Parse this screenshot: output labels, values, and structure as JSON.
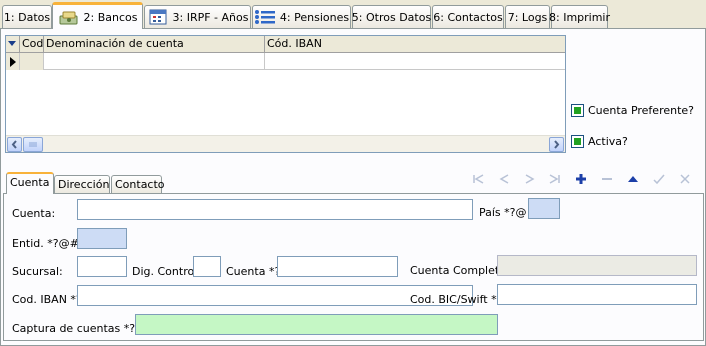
{
  "top_tabs": [
    {
      "label": "1: Datos",
      "icon": "none"
    },
    {
      "label": "2: Bancos",
      "icon": "money-icon",
      "active": true
    },
    {
      "label": "3: IRPF - Años",
      "icon": "calendar-icon"
    },
    {
      "label": "4: Pensiones",
      "icon": "list-icon"
    },
    {
      "label": "5: Otros Datos",
      "icon": "none"
    },
    {
      "label": "6: Contactos",
      "icon": "none"
    },
    {
      "label": "7: Logs",
      "icon": "none"
    },
    {
      "label": "8: Imprimir",
      "icon": "none"
    }
  ],
  "grid": {
    "columns": [
      "Cod.",
      "Denominación de cuenta",
      "Cód. IBAN"
    ],
    "rows": [
      [
        "",
        "",
        ""
      ]
    ]
  },
  "checkboxes": {
    "preferente": "Cuenta Preferente?",
    "activa": "Activa?"
  },
  "sub_tabs": [
    "Cuenta",
    "Dirección",
    "Contacto"
  ],
  "nav_icons": [
    "first-icon",
    "prev-icon",
    "next-icon",
    "last-icon",
    "add-icon",
    "delete-icon",
    "edit-icon",
    "save-icon",
    "cancel-icon"
  ],
  "form": {
    "cuenta_label": "Cuenta:",
    "pais_label": "País *?@",
    "entidad_label": "Entid. *?@#",
    "sucursal_label": "Sucursal:",
    "dig_control_label": "Dig. Control:",
    "cuenta2_label": "Cuenta *?",
    "cuenta_completa_label": "Cuenta Completa:",
    "iban_label": "Cod. IBAN *?",
    "bic_label": "Cod. BIC/Swift *?",
    "captura_label": "Captura de cuentas *?@"
  },
  "colors": {
    "accent_tab": "#f8b23a",
    "required_field": "#cddcf5",
    "capture_field": "#c5f7c5",
    "checkbox_fill": "#21a121"
  }
}
